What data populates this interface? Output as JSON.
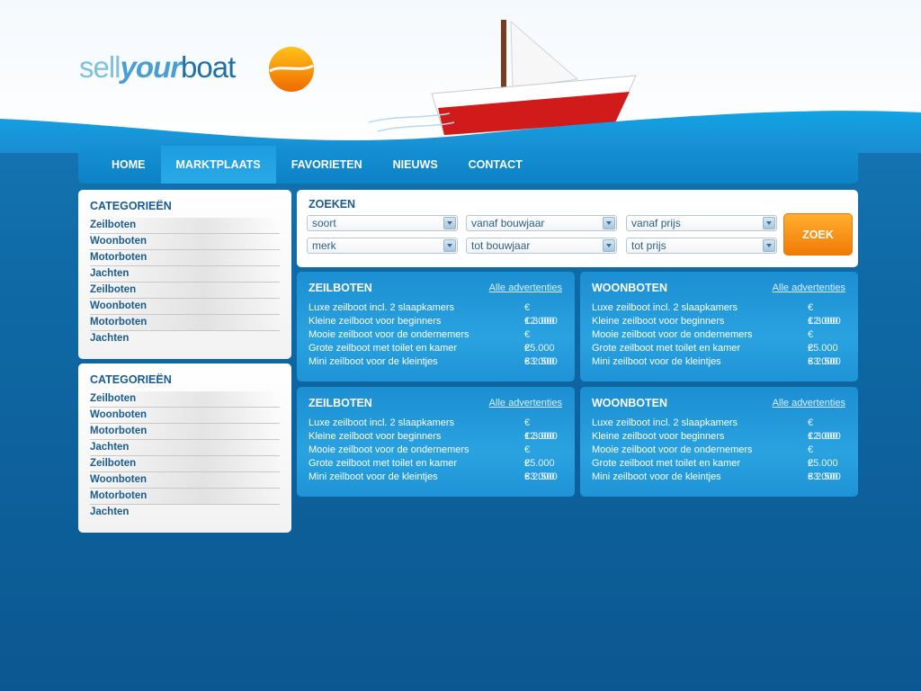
{
  "logo": {
    "part1": "sell",
    "part2": "your",
    "part3": "boat"
  },
  "nav": {
    "items": [
      {
        "label": "HOME"
      },
      {
        "label": "MARKTPLAATS"
      },
      {
        "label": "FAVORIETEN"
      },
      {
        "label": "NIEUWS"
      },
      {
        "label": "CONTACT"
      }
    ],
    "active_index": 1
  },
  "sidebar": [
    {
      "title": "CATEGORIEËN",
      "items": [
        "Zeilboten",
        "Woonboten",
        "Motorboten",
        "Jachten",
        "Zeilboten",
        "Woonboten",
        "Motorboten",
        "Jachten"
      ]
    },
    {
      "title": "CATEGORIEËN",
      "items": [
        "Zeilboten",
        "Woonboten",
        "Motorboten",
        "Jachten",
        "Zeilboten",
        "Woonboten",
        "Motorboten",
        "Jachten"
      ]
    }
  ],
  "search": {
    "title": "ZOEKEN",
    "selects": {
      "soort": "soort",
      "vanaf_bouwjaar": "vanaf bouwjaar",
      "vanaf_prijs": "vanaf prijs",
      "merk": "merk",
      "tot_bouwjaar": "tot bouwjaar",
      "tot_prijs": "tot prijs"
    },
    "button": "ZOEK"
  },
  "panels": [
    {
      "title": "ZEILBOTEN",
      "link": "Alle advertenties",
      "rows": [
        {
          "name": "Luxe zeilboot incl. 2 slaapkamers",
          "price": "€ 12.000"
        },
        {
          "name": "Kleine zeilboot voor beginners",
          "price": "€ 3.000"
        },
        {
          "name": "Mooie zeilboot voor de ondernemers",
          "price": "€ 25.000"
        },
        {
          "name": "Grote zeilboot met toilet en kamer",
          "price": "€ 33.000"
        },
        {
          "name": "Mini zeilboot voor de kleintjes",
          "price": "€ 2.500"
        }
      ]
    },
    {
      "title": "WOONBOTEN",
      "link": "Alle advertenties",
      "rows": [
        {
          "name": "Luxe zeilboot incl. 2 slaapkamers",
          "price": "€ 12.000"
        },
        {
          "name": "Kleine zeilboot voor beginners",
          "price": "€ 3.000"
        },
        {
          "name": "Mooie zeilboot voor de ondernemers",
          "price": "€ 25.000"
        },
        {
          "name": "Grote zeilboot met toilet en kamer",
          "price": "€ 33.000"
        },
        {
          "name": "Mini zeilboot voor de kleintjes",
          "price": "€ 2.500"
        }
      ]
    },
    {
      "title": "ZEILBOTEN",
      "link": "Alle advertenties",
      "rows": [
        {
          "name": "Luxe zeilboot incl. 2 slaapkamers",
          "price": "€ 12.000"
        },
        {
          "name": "Kleine zeilboot voor beginners",
          "price": "€ 3.000"
        },
        {
          "name": "Mooie zeilboot voor de ondernemers",
          "price": "€ 25.000"
        },
        {
          "name": "Grote zeilboot met toilet en kamer",
          "price": "€ 33.000"
        },
        {
          "name": "Mini zeilboot voor de kleintjes",
          "price": "€ 2.500"
        }
      ]
    },
    {
      "title": "WOONBOTEN",
      "link": "Alle advertenties",
      "rows": [
        {
          "name": "Luxe zeilboot incl. 2 slaapkamers",
          "price": "€ 12.000"
        },
        {
          "name": "Kleine zeilboot voor beginners",
          "price": "€ 3.000"
        },
        {
          "name": "Mooie zeilboot voor de ondernemers",
          "price": "€ 25.000"
        },
        {
          "name": "Grote zeilboot met toilet en kamer",
          "price": "€ 33.000"
        },
        {
          "name": "Mini zeilboot voor de kleintjes",
          "price": "€ 2.500"
        }
      ]
    }
  ]
}
